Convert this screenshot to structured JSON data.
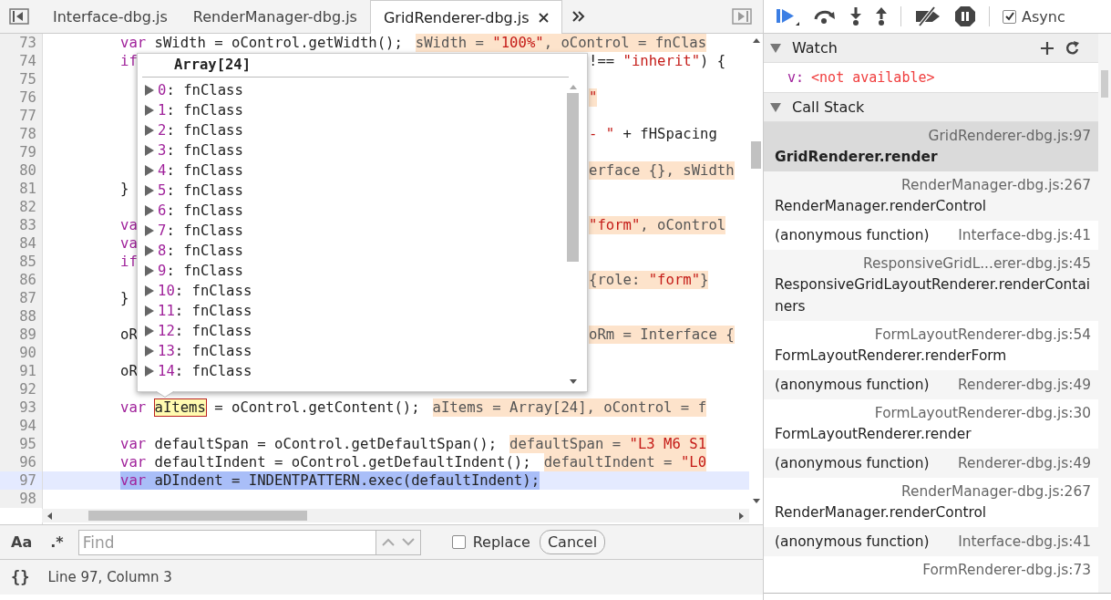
{
  "tabs": [
    {
      "label": "Interface-dbg.js",
      "selected": false
    },
    {
      "label": "RenderManager-dbg.js",
      "selected": false
    },
    {
      "label": "GridRenderer-dbg.js",
      "selected": true
    }
  ],
  "code_lines": [
    {
      "number": "73",
      "code": [
        {
          "text": "var",
          "kind": "keyword"
        },
        {
          "text": " sWidth = oControl.getWidth();",
          "kind": "plain"
        }
      ],
      "value": [
        {
          "text": "sWidth = ",
          "kind": "value"
        },
        {
          "text": "\"100%\"",
          "kind": "value-string"
        },
        {
          "text": ", oControl = fnClas",
          "kind": "value"
        }
      ]
    },
    {
      "number": "74",
      "code": [
        {
          "text": "if",
          "kind": "keyword"
        }
      ],
      "after_popup": [
        {
          "text": "!== ",
          "kind": "plain"
        },
        {
          "text": "\"inherit\"",
          "kind": "string"
        },
        {
          "text": ") {",
          "kind": "plain"
        }
      ]
    },
    {
      "number": "75"
    },
    {
      "number": "76",
      "after_popup": [
        {
          "text": "\"",
          "kind": "value-string"
        }
      ]
    },
    {
      "number": "77"
    },
    {
      "number": "78",
      "after_popup": [
        {
          "text": "- \"",
          "kind": "string"
        },
        {
          "text": " + fHSpacing",
          "kind": "plain"
        }
      ]
    },
    {
      "number": "79"
    },
    {
      "number": "80",
      "after_popup": [
        {
          "text": "erface {}, sWidth",
          "kind": "value"
        }
      ]
    },
    {
      "number": "81",
      "code": [
        {
          "text": "}",
          "kind": "plain"
        }
      ]
    },
    {
      "number": "82"
    },
    {
      "number": "83",
      "code": [
        {
          "text": "va",
          "kind": "keyword"
        }
      ],
      "after_popup": [
        {
          "text": "\"form\"",
          "kind": "value-string"
        },
        {
          "text": ", oControl",
          "kind": "value"
        }
      ]
    },
    {
      "number": "84",
      "code": [
        {
          "text": "va",
          "kind": "keyword"
        }
      ]
    },
    {
      "number": "85",
      "code": [
        {
          "text": "if",
          "kind": "keyword"
        }
      ]
    },
    {
      "number": "86",
      "after_popup": [
        {
          "text": "{role: ",
          "kind": "value"
        },
        {
          "text": "\"form\"",
          "kind": "value-string"
        },
        {
          "text": "}",
          "kind": "value"
        }
      ]
    },
    {
      "number": "87",
      "code": [
        {
          "text": "}",
          "kind": "plain"
        }
      ]
    },
    {
      "number": "88"
    },
    {
      "number": "89",
      "code": [
        {
          "text": "oR",
          "kind": "plain"
        }
      ],
      "after_popup": [
        {
          "text": "oRm = Interface {",
          "kind": "value"
        }
      ]
    },
    {
      "number": "90"
    },
    {
      "number": "91",
      "code": [
        {
          "text": "oR",
          "kind": "plain"
        }
      ]
    },
    {
      "number": "92"
    },
    {
      "number": "93",
      "code": [
        {
          "text": "var",
          "kind": "keyword"
        },
        {
          "text": "aItems",
          "kind": "hover"
        },
        {
          "text": " = oControl.getContent();",
          "kind": "plain"
        }
      ],
      "value": [
        {
          "text": "aItems = Array[24], oControl = f",
          "kind": "value"
        }
      ]
    },
    {
      "number": "94"
    },
    {
      "number": "95",
      "code": [
        {
          "text": "var",
          "kind": "keyword"
        },
        {
          "text": " defaultSpan = oControl.getDefaultSpan();",
          "kind": "plain"
        }
      ],
      "value": [
        {
          "text": "defaultSpan = ",
          "kind": "value"
        },
        {
          "text": "\"L3 M6 S1",
          "kind": "value-string"
        }
      ]
    },
    {
      "number": "96",
      "code": [
        {
          "text": "var",
          "kind": "keyword"
        },
        {
          "text": " defaultIndent = oControl.getDefaultIndent();",
          "kind": "plain"
        }
      ],
      "value": [
        {
          "text": "defaultIndent = ",
          "kind": "value"
        },
        {
          "text": "\"L0",
          "kind": "value-string"
        }
      ]
    },
    {
      "number": "97",
      "current": true,
      "code": [
        {
          "text": "var",
          "kind": "keyword"
        },
        {
          "text": " aDIndent = INDENTPATTERN.exec(defaultIndent);",
          "kind": "plain"
        }
      ]
    },
    {
      "number": "98"
    }
  ],
  "popup": {
    "title": "Array[24]",
    "items": [
      {
        "key": "0",
        "rest": ": fnClass",
        "expanded": false
      },
      {
        "key": "1",
        "rest": ": fnClass",
        "expanded": false
      },
      {
        "key": "2",
        "rest": ": fnClass",
        "expanded": false
      },
      {
        "key": "3",
        "rest": ": fnClass",
        "expanded": false
      },
      {
        "key": "4",
        "rest": ": fnClass",
        "expanded": false
      },
      {
        "key": "5",
        "rest": ": fnClass",
        "expanded": false
      },
      {
        "key": "6",
        "rest": ": fnClass",
        "expanded": false
      },
      {
        "key": "7",
        "rest": ": fnClass",
        "expanded": false
      },
      {
        "key": "8",
        "rest": ": fnClass",
        "expanded": false
      },
      {
        "key": "9",
        "rest": ": fnClass",
        "expanded": false
      },
      {
        "key": "10",
        "rest": ": fnClass",
        "expanded": false
      },
      {
        "key": "11",
        "rest": ": fnClass",
        "expanded": false
      },
      {
        "key": "12",
        "rest": ": fnClass",
        "expanded": false
      },
      {
        "key": "13",
        "rest": ": fnClass",
        "expanded": false
      },
      {
        "key": "14",
        "rest": ": fnClass",
        "expanded": false
      }
    ]
  },
  "find_bar": {
    "case_toggle": "Aa",
    "regex_toggle": ".*",
    "placeholder": "Find",
    "replace": {
      "label": "Replace",
      "checked": false
    },
    "cancel": "Cancel"
  },
  "status_bar": {
    "format_toggle": "{}",
    "position": "Line 97, Column 3"
  },
  "debugger": {
    "async": {
      "label": "Async",
      "checked": true
    },
    "watch": {
      "title": "Watch",
      "expanded": true,
      "items": [
        {
          "name": "v:",
          "value": "<not available>"
        }
      ]
    },
    "call_stack": {
      "title": "Call Stack",
      "expanded": true,
      "frames": [
        {
          "kind": "stacked",
          "location": "GridRenderer-dbg.js:97",
          "function": "GridRenderer.render",
          "selected": true
        },
        {
          "kind": "stacked",
          "location": "RenderManager-dbg.js:267",
          "function": "RenderManager.renderControl",
          "selected": false
        },
        {
          "kind": "inline",
          "location": "Interface-dbg.js:41",
          "function": "(anonymous function)",
          "selected": false
        },
        {
          "kind": "stacked",
          "location": "ResponsiveGridL...erer-dbg.js:45",
          "function": "ResponsiveGridLayoutRenderer.renderContainers",
          "selected": false
        },
        {
          "kind": "stacked",
          "location": "FormLayoutRenderer-dbg.js:54",
          "function": "FormLayoutRenderer.renderForm",
          "selected": false
        },
        {
          "kind": "inline",
          "location": "Renderer-dbg.js:49",
          "function": "(anonymous function)",
          "selected": false
        },
        {
          "kind": "stacked",
          "location": "FormLayoutRenderer-dbg.js:30",
          "function": "FormLayoutRenderer.render",
          "selected": false
        },
        {
          "kind": "inline",
          "location": "Renderer-dbg.js:49",
          "function": "(anonymous function)",
          "selected": false
        },
        {
          "kind": "stacked",
          "location": "RenderManager-dbg.js:267",
          "function": "RenderManager.renderControl",
          "selected": false
        },
        {
          "kind": "inline",
          "location": "Interface-dbg.js:41",
          "function": "(anonymous function)",
          "selected": false
        },
        {
          "kind": "stacked",
          "location": "FormRenderer-dbg.js:73",
          "selected": false
        }
      ]
    }
  }
}
